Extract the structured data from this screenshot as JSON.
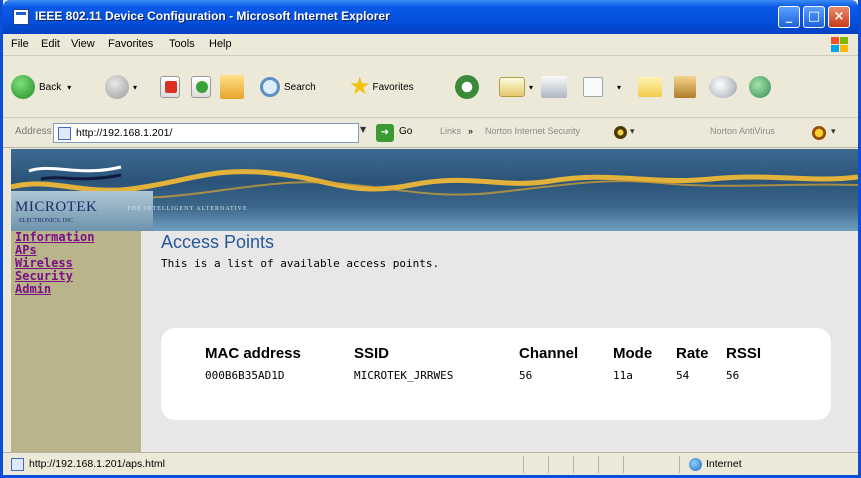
{
  "window": {
    "title": "IEEE 802.11 Device Configuration - Microsoft Internet Explorer",
    "controls": {
      "minimize": "_",
      "maximize": "□",
      "close": "×"
    }
  },
  "menubar": [
    "File",
    "Edit",
    "View",
    "Favorites",
    "Tools",
    "Help"
  ],
  "toolbar": {
    "back_label": "Back",
    "search_label": "Search",
    "favorites_label": "Favorites"
  },
  "addressbar": {
    "label": "Address",
    "url": "http://192.168.1.201/",
    "go_label": "Go",
    "links_label": "Links",
    "links_chevron": "»",
    "norton_security": "Norton Internet Security",
    "norton_antivirus": "Norton AntiVirus"
  },
  "banner": {
    "logo": "MICROTEK",
    "logo_sub": "ELECTRONICS, INC",
    "tagline": "THE INTELLIGENT ALTERNATIVE"
  },
  "sidebar": {
    "links": [
      "Information",
      "APs",
      "Wireless",
      "Security",
      "Admin"
    ]
  },
  "page": {
    "title": "Access Points",
    "description": "This is a list of available access points."
  },
  "table": {
    "headers": [
      "MAC address",
      "SSID",
      "Channel",
      "Mode",
      "Rate",
      "RSSI"
    ],
    "rows": [
      [
        "000B6B35AD1D",
        "MICROTEK_JRRWES",
        "56",
        "11a",
        "54",
        "56"
      ]
    ]
  },
  "statusbar": {
    "url": "http://192.168.1.201/aps.html",
    "zone": "Internet"
  },
  "colors": {
    "title_bar": "#0550dc",
    "sidebar_bg": "#bab48a",
    "nav_link": "#7a0f86",
    "page_title": "#245a9c"
  }
}
